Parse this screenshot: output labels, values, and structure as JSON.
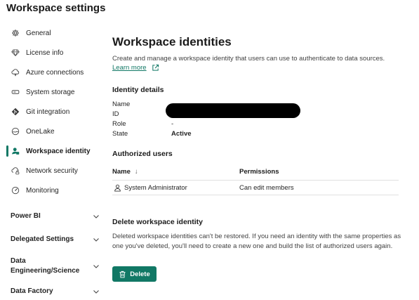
{
  "header": {
    "title": "Workspace settings"
  },
  "sidebar": {
    "items": [
      {
        "label": "General",
        "icon": "gear-icon"
      },
      {
        "label": "License info",
        "icon": "diamond-icon"
      },
      {
        "label": "Azure connections",
        "icon": "cloud-plug-icon"
      },
      {
        "label": "System storage",
        "icon": "storage-icon"
      },
      {
        "label": "Git integration",
        "icon": "git-icon"
      },
      {
        "label": "OneLake",
        "icon": "onelake-icon"
      },
      {
        "label": "Workspace identity",
        "icon": "identity-icon",
        "active": true
      },
      {
        "label": "Network security",
        "icon": "cloud-lock-icon"
      },
      {
        "label": "Monitoring",
        "icon": "gauge-icon"
      }
    ],
    "sections": [
      {
        "label": "Power BI"
      },
      {
        "label": "Delegated Settings"
      },
      {
        "label_line1": "Data",
        "label_line2": "Engineering/Science"
      },
      {
        "label": "Data Factory"
      }
    ]
  },
  "main": {
    "title": "Workspace identities",
    "description": "Create and manage a workspace identity that users can use to authenticate to data sources.",
    "learn_more": "Learn more",
    "identity_details": {
      "heading": "Identity details",
      "rows": [
        {
          "label": "Name",
          "value": ""
        },
        {
          "label": "ID",
          "value": ""
        },
        {
          "label": "Role",
          "value": "-"
        },
        {
          "label": "State",
          "value": "Active"
        }
      ]
    },
    "authorized_users": {
      "heading": "Authorized users",
      "columns": {
        "name": "Name",
        "sort": "↓",
        "permissions": "Permissions"
      },
      "rows": [
        {
          "name": "System Administrator",
          "permissions": "Can edit members"
        }
      ]
    },
    "delete": {
      "heading": "Delete workspace identity",
      "description": "Deleted workspace identities can't be restored. If you need an identity with the same properties as one you've deleted, you'll need to create a new one and build the list of authorized users again.",
      "button_label": "Delete"
    }
  },
  "colors": {
    "accent": "#117865",
    "text": "#242424"
  }
}
